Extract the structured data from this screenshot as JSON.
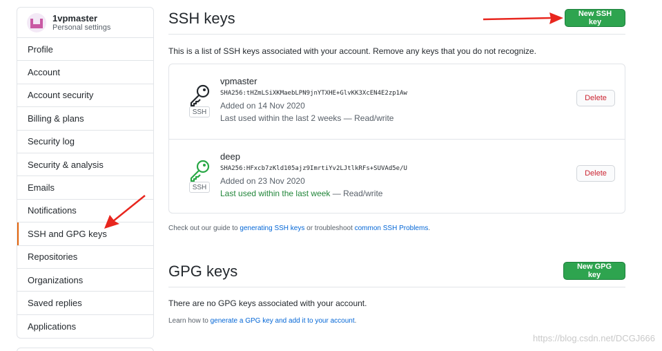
{
  "profile": {
    "username": "1vpmaster",
    "subtitle": "Personal settings"
  },
  "sidebar": {
    "items": [
      {
        "label": "Profile"
      },
      {
        "label": "Account"
      },
      {
        "label": "Account security"
      },
      {
        "label": "Billing & plans"
      },
      {
        "label": "Security log"
      },
      {
        "label": "Security & analysis"
      },
      {
        "label": "Emails"
      },
      {
        "label": "Notifications"
      },
      {
        "label": "SSH and GPG keys",
        "active": true
      },
      {
        "label": "Repositories"
      },
      {
        "label": "Organizations"
      },
      {
        "label": "Saved replies"
      },
      {
        "label": "Applications"
      }
    ]
  },
  "ssh": {
    "title": "SSH keys",
    "new_button": "New SSH key",
    "intro": "This is a list of SSH keys associated with your account. Remove any keys that you do not recognize.",
    "keys": [
      {
        "name": "vpmaster",
        "fingerprint": "SHA256:tHZmLSiXKMaebLPN9jnYTXHE+GlvKK3XcEN4E2zp1Aw",
        "added": "Added on 14 Nov 2020",
        "used_recent": "",
        "used": "Last used within the last 2 weeks — Read/write",
        "badge": "SSH",
        "delete_label": "Delete",
        "icon_color": "#24292e"
      },
      {
        "name": "deep",
        "fingerprint": "SHA256:HFxcb7zKld105ajz9ImrtiYv2LJtlkRFs+SUVAd5e/U",
        "added": "Added on 23 Nov 2020",
        "used_recent": "Last used within the last week",
        "used": " — Read/write",
        "badge": "SSH",
        "delete_label": "Delete",
        "icon_color": "#28a745"
      }
    ],
    "guide_prefix": "Check out our guide to ",
    "guide_link1": "generating SSH keys",
    "guide_mid": " or troubleshoot ",
    "guide_link2": "common SSH Problems",
    "guide_suffix": "."
  },
  "gpg": {
    "title": "GPG keys",
    "new_button": "New GPG key",
    "empty": "There are no GPG keys associated with your account.",
    "learn_prefix": "Learn how to ",
    "learn_link": "generate a GPG key and add it to your account",
    "learn_suffix": "."
  },
  "watermark": "https://blog.csdn.net/DCGJ666",
  "colors": {
    "accent_green": "#2ea44f",
    "danger": "#cb2431",
    "link": "#0366d6",
    "annotation_red": "#e8261e"
  },
  "icons": {
    "key": "key-icon",
    "arrow": "red-annotation-arrow"
  }
}
